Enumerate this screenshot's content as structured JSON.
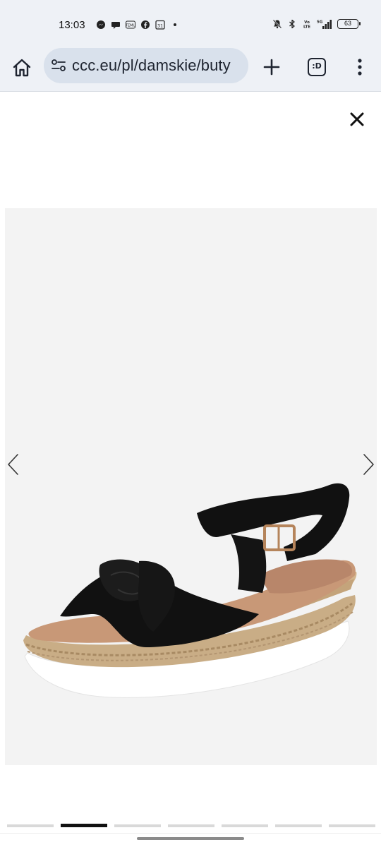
{
  "status_bar": {
    "time": "13:03",
    "battery": "63",
    "left_icons": [
      "messenger-icon",
      "chat-bubble-icon",
      "temu-icon",
      "facebook-icon",
      "calendar-icon",
      "dot-icon"
    ],
    "right_icons": [
      "mute-bell-icon",
      "bluetooth-icon",
      "volte-icon",
      "5g-signal-icon",
      "battery-icon"
    ]
  },
  "browser": {
    "url": "ccc.eu/pl/damskie/buty",
    "tabs_label": ":D"
  },
  "gallery": {
    "product_alt": "black knotted wedge sandal",
    "slide_count": 7,
    "active_slide": 2
  },
  "colors": {
    "toolbar_bg": "#eef1f6",
    "url_pill_bg": "#d9e1ec",
    "gallery_bg": "#f3f3f3",
    "active_dot": "#111111"
  }
}
